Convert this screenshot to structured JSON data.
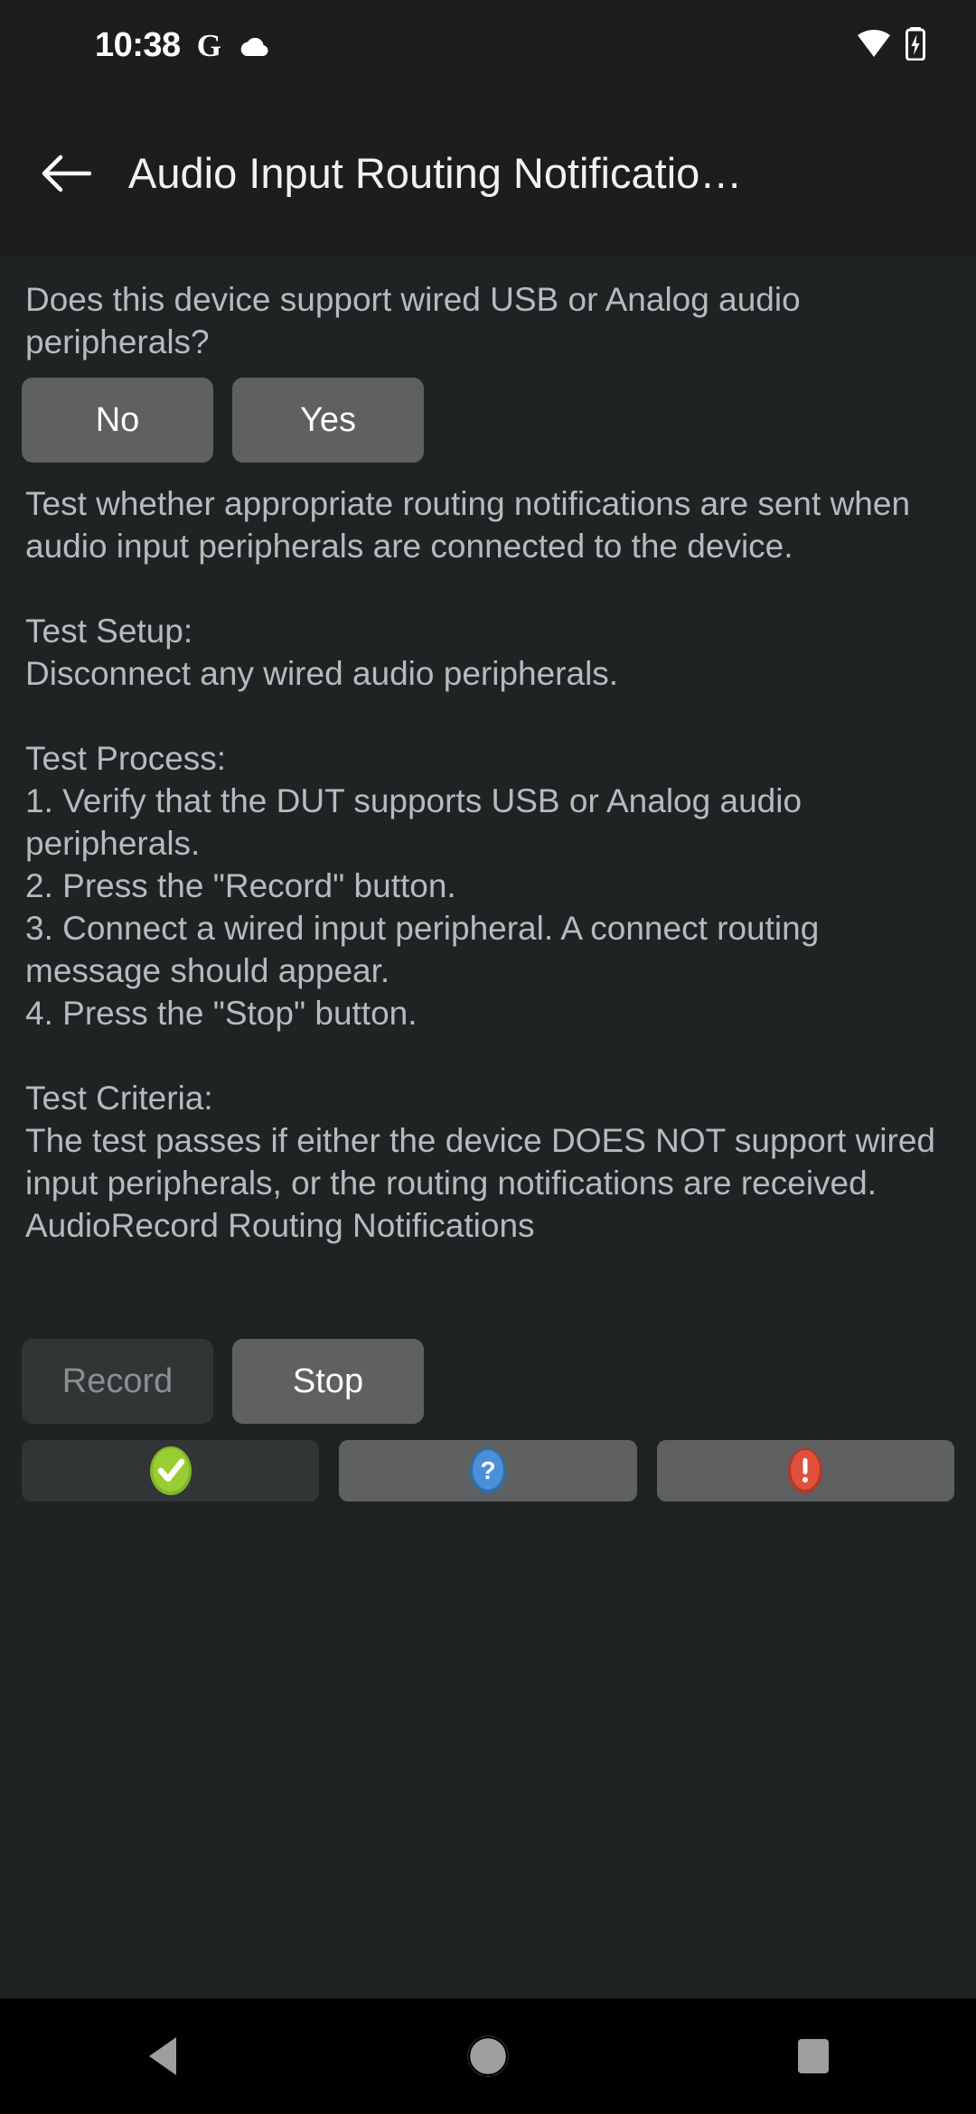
{
  "status_bar": {
    "time": "10:38",
    "google_icon": "google-g-icon",
    "cloud_icon": "cloud-icon",
    "wifi_icon": "wifi-icon",
    "battery_icon": "battery-charging-icon"
  },
  "app_bar": {
    "back_icon": "back-arrow-icon",
    "title": "Audio Input Routing Notificatio…"
  },
  "content": {
    "question": "Does this device support wired USB or Analog audio peripherals?",
    "answer_buttons": [
      {
        "label": "No",
        "name": "no-button",
        "state": "enabled"
      },
      {
        "label": "Yes",
        "name": "yes-button",
        "state": "enabled"
      }
    ],
    "description": "Test whether appropriate routing notifications are sent when audio input peripherals are connected to the device.\n\nTest Setup:\nDisconnect any wired audio peripherals.\n\nTest Process:\n1. Verify that the DUT supports USB or Analog audio peripherals.\n2. Press the \"Record\" button.\n3. Connect a wired input peripheral. A connect routing message should appear.\n4. Press the \"Stop\" button.\n\nTest Criteria:\nThe test passes if either the device DOES NOT support wired input peripherals, or the routing notifications are received.",
    "status_line": "AudioRecord Routing Notifications",
    "transport_buttons": [
      {
        "label": "Record",
        "name": "record-button",
        "state": "disabled"
      },
      {
        "label": "Stop",
        "name": "stop-button",
        "state": "enabled"
      }
    ],
    "verdict_buttons": [
      {
        "name": "pass-button",
        "icon": "check-circle-icon",
        "state": "disabled",
        "color": "#8DC63F"
      },
      {
        "name": "info-button",
        "icon": "question-circle-icon",
        "state": "enabled",
        "color": "#4A90D9"
      },
      {
        "name": "fail-button",
        "icon": "exclamation-circle-icon",
        "state": "enabled",
        "color": "#E0503A"
      }
    ]
  },
  "nav_bar": {
    "back": "nav-back-icon",
    "home": "nav-home-icon",
    "recents": "nav-recents-icon"
  },
  "colors": {
    "window_background": "#1b1d1e",
    "content_background": "#202324",
    "button_enabled": "#5f6061",
    "button_disabled": "#323536",
    "text_primary": "#f1f1f1",
    "text_secondary": "#b6bbbe",
    "nav_background": "#000000",
    "nav_icon": "#9e9e9e"
  }
}
